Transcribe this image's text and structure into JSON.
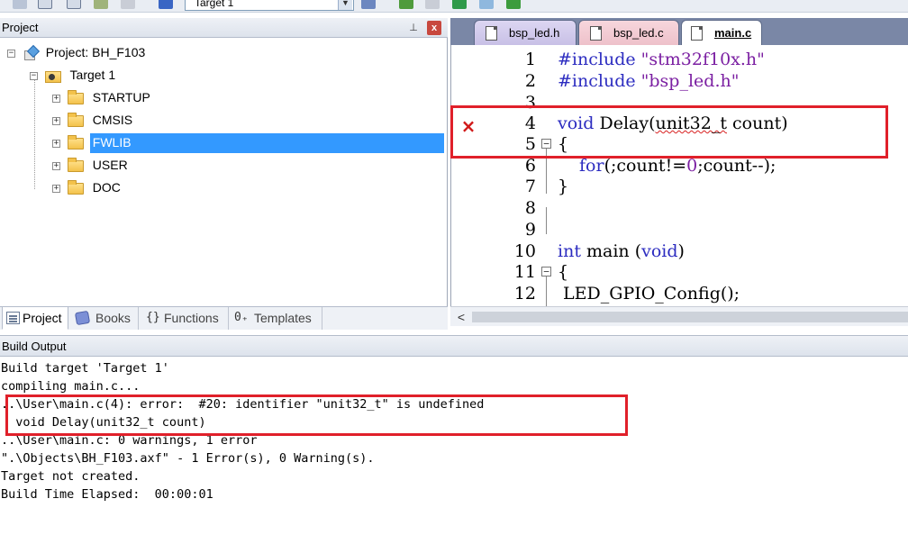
{
  "toolbar": {
    "target_value": "Target 1"
  },
  "project_panel": {
    "title": "Project",
    "pin_glyph": "ᵩ",
    "close_glyph": "x",
    "tree": {
      "root": "Project: BH_F103",
      "target": "Target 1",
      "groups": [
        "STARTUP",
        "CMSIS",
        "FWLIB",
        "USER",
        "DOC"
      ],
      "selected": "FWLIB"
    },
    "tabs": [
      "Project",
      "Books",
      "Functions",
      "Templates"
    ],
    "tab_glyphs": {
      "functions": "{}",
      "templates": "0₊"
    }
  },
  "editor": {
    "tabs": [
      {
        "label": "bsp_led.h",
        "active": false,
        "color": "#c8c0e6"
      },
      {
        "label": "bsp_led.c",
        "active": false,
        "color": "#eec1ca"
      },
      {
        "label": "main.c",
        "active": true,
        "color": "#ffffff"
      }
    ],
    "lines": [
      {
        "num": "1",
        "parts": [
          "#include ",
          "\"stm32f10x.h\""
        ]
      },
      {
        "num": "2",
        "parts": [
          "#include ",
          "\"bsp_led.h\""
        ]
      },
      {
        "num": "3",
        "parts": [
          ""
        ]
      },
      {
        "num": "4",
        "parts": [
          "void",
          " Delay(",
          "unit32_t",
          " count)"
        ]
      },
      {
        "num": "5",
        "parts": [
          "{"
        ]
      },
      {
        "num": "6",
        "parts": [
          "for",
          "(;count!=",
          "0",
          ";count--);"
        ]
      },
      {
        "num": "7",
        "parts": [
          "}"
        ]
      },
      {
        "num": "8",
        "parts": [
          ""
        ]
      },
      {
        "num": "9",
        "parts": [
          ""
        ]
      },
      {
        "num": "10",
        "parts": [
          "int",
          " main (",
          "void",
          ")"
        ]
      },
      {
        "num": "11",
        "parts": [
          "{"
        ]
      },
      {
        "num": "12",
        "parts": [
          " LED_GPIO_Config();"
        ]
      }
    ],
    "error_marker": "×",
    "fold_glyph": "−",
    "scroll_left_glyph": "<"
  },
  "build_output": {
    "title": "Build Output",
    "lines": [
      "Build target 'Target 1'",
      "compiling main.c...",
      "..\\User\\main.c(4): error:  #20: identifier \"unit32_t\" is undefined",
      "  void Delay(unit32_t count)",
      "..\\User\\main.c: 0 warnings, 1 error",
      "\".\\Objects\\BH_F103.axf\" - 1 Error(s), 0 Warning(s).",
      "Target not created.",
      "Build Time Elapsed:  00:00:01"
    ]
  },
  "colors": {
    "highlight_box": "#e0202a",
    "keyword": "#2c2cc0",
    "string": "#7b1fa2",
    "selection": "#3399ff"
  }
}
